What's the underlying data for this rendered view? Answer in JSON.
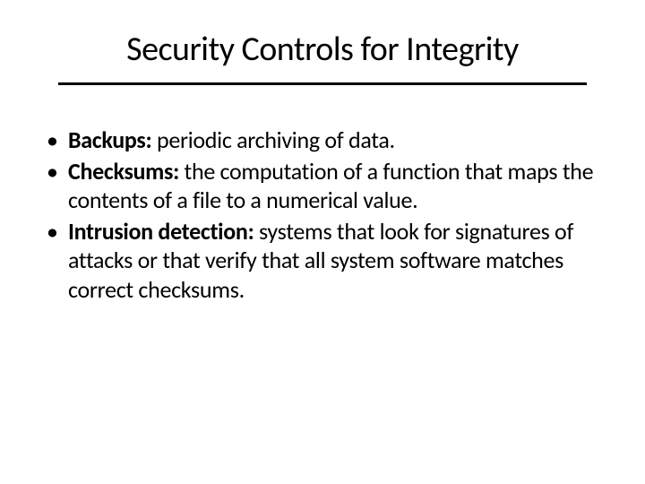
{
  "title": "Security Controls for Integrity",
  "bullets": [
    {
      "term": "Backups:",
      "desc": " periodic archiving of data."
    },
    {
      "term": "Checksums:",
      "desc": " the computation of a function that maps the contents of a file to a numerical value."
    },
    {
      "term": "Intrusion detection:",
      "desc": " systems that look for signatures of attacks or that verify that all system software matches correct checksums."
    }
  ]
}
